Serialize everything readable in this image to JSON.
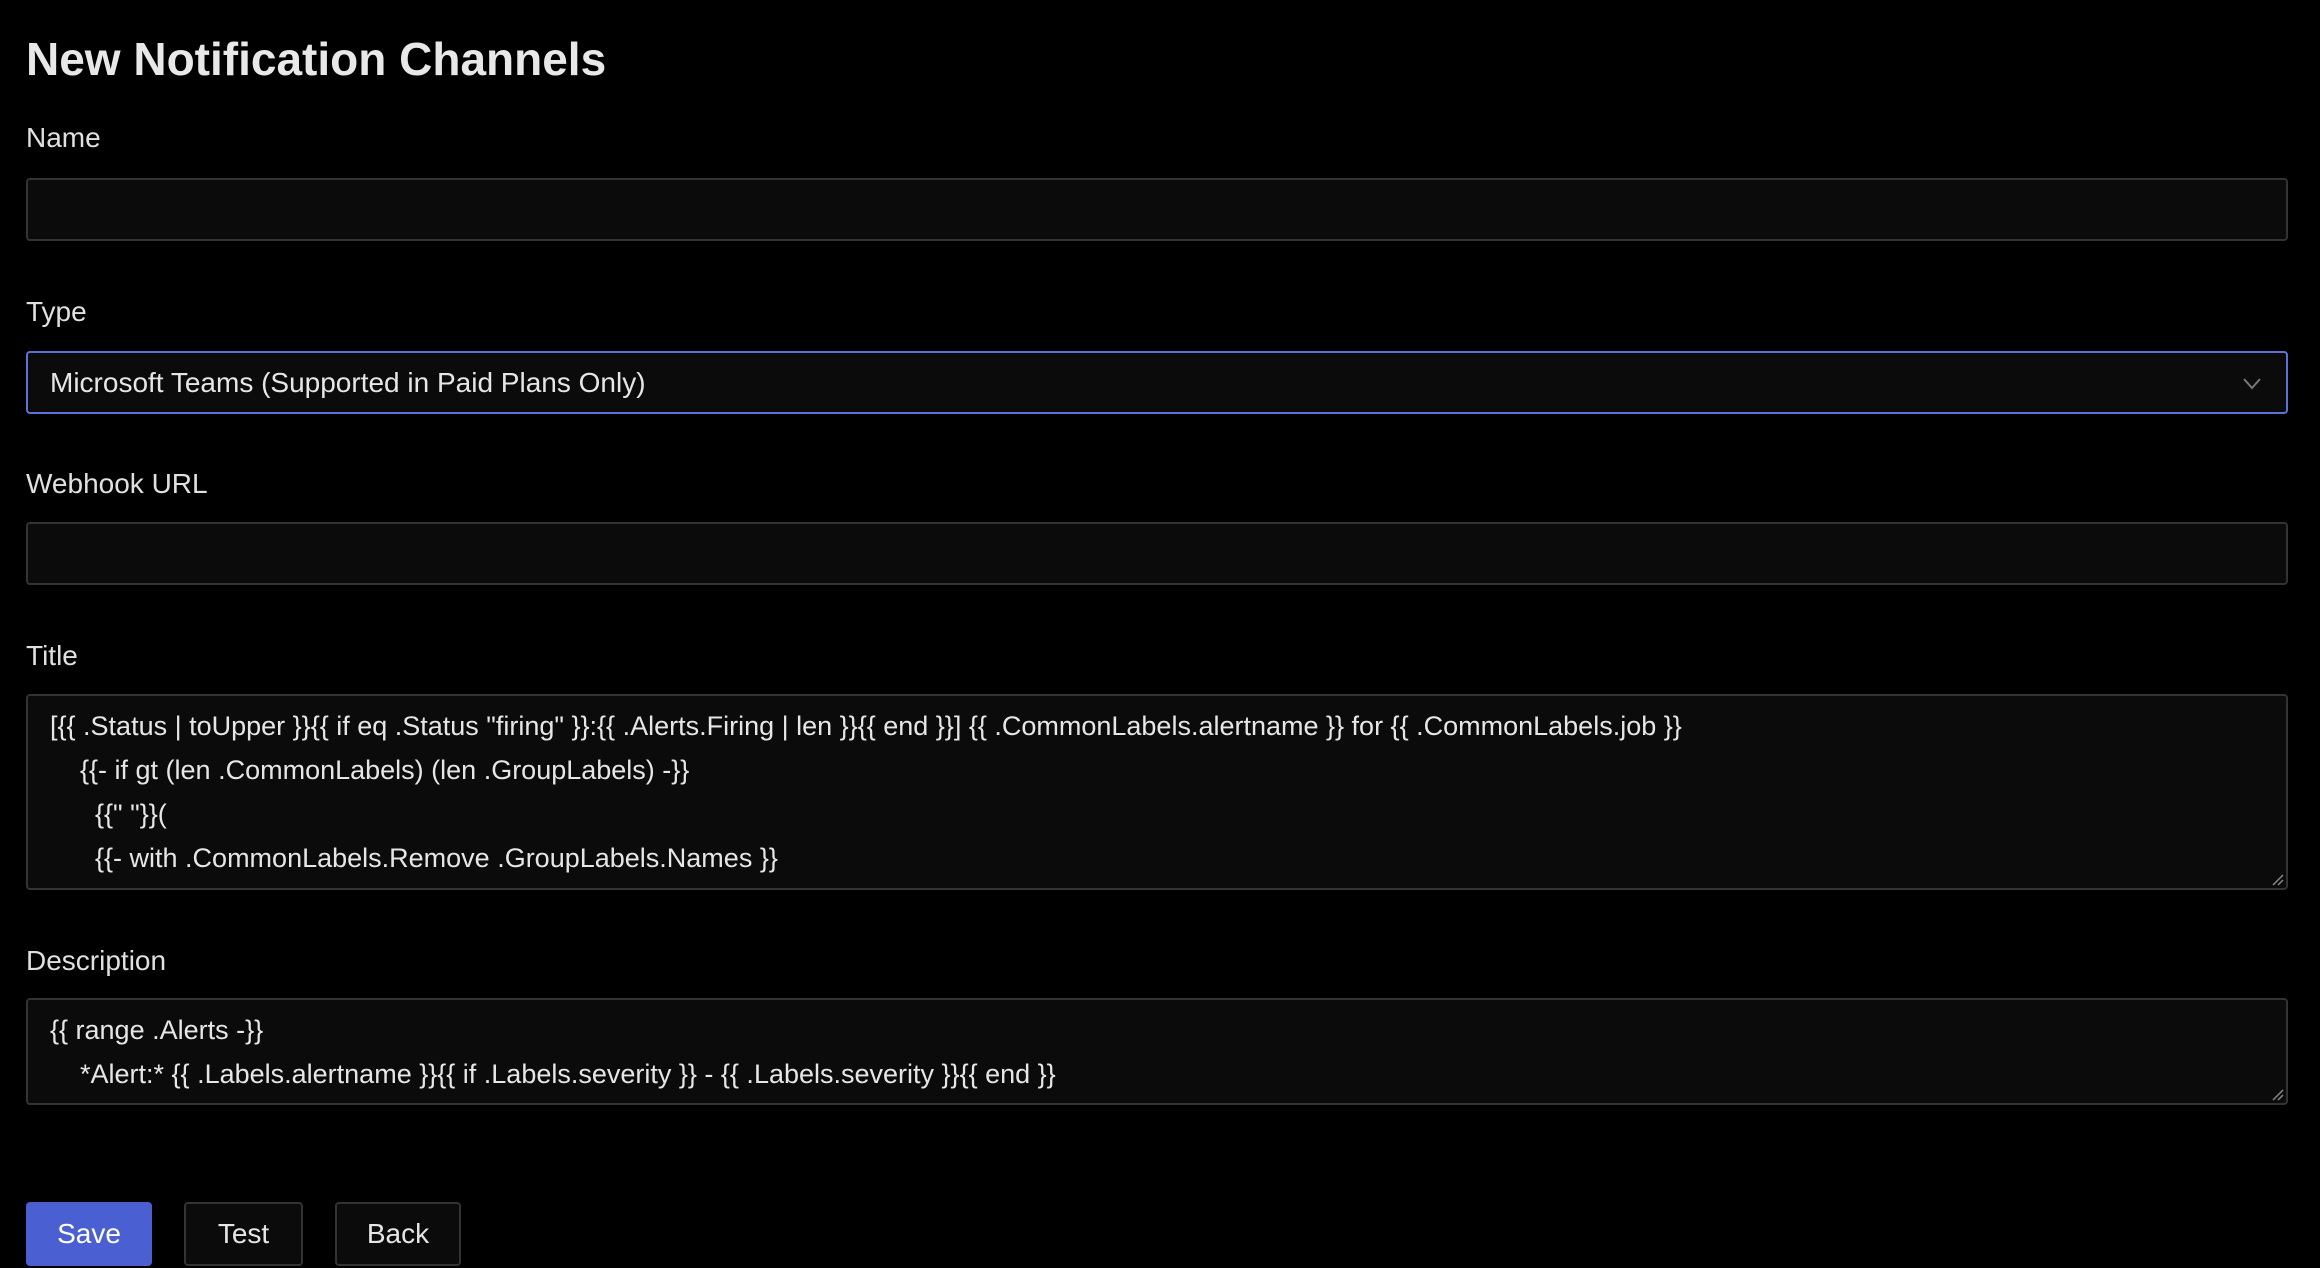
{
  "page": {
    "title": "New Notification Channels"
  },
  "form": {
    "name": {
      "label": "Name",
      "value": ""
    },
    "type": {
      "label": "Type",
      "value": "Microsoft Teams (Supported in Paid Plans Only)",
      "icon": "chevron-down-icon"
    },
    "webhook": {
      "label": "Webhook URL",
      "value": ""
    },
    "title": {
      "label": "Title",
      "value": "[{{ .Status | toUpper }}{{ if eq .Status \"firing\" }}:{{ .Alerts.Firing | len }}{{ end }}] {{ .CommonLabels.alertname }} for {{ .CommonLabels.job }}\n    {{- if gt (len .CommonLabels) (len .GroupLabels) -}}\n      {{\" \"}}(\n      {{- with .CommonLabels.Remove .GroupLabels.Names }}"
    },
    "description": {
      "label": "Description",
      "value": "{{ range .Alerts -}}\n    *Alert:* {{ .Labels.alertname }}{{ if .Labels.severity }} - {{ .Labels.severity }}{{ end }}"
    }
  },
  "actions": {
    "save": "Save",
    "test": "Test",
    "back": "Back"
  },
  "colors": {
    "accent": "#4a5fd1",
    "select_border": "#5b73d9",
    "field_bg": "#0b0b0b"
  }
}
